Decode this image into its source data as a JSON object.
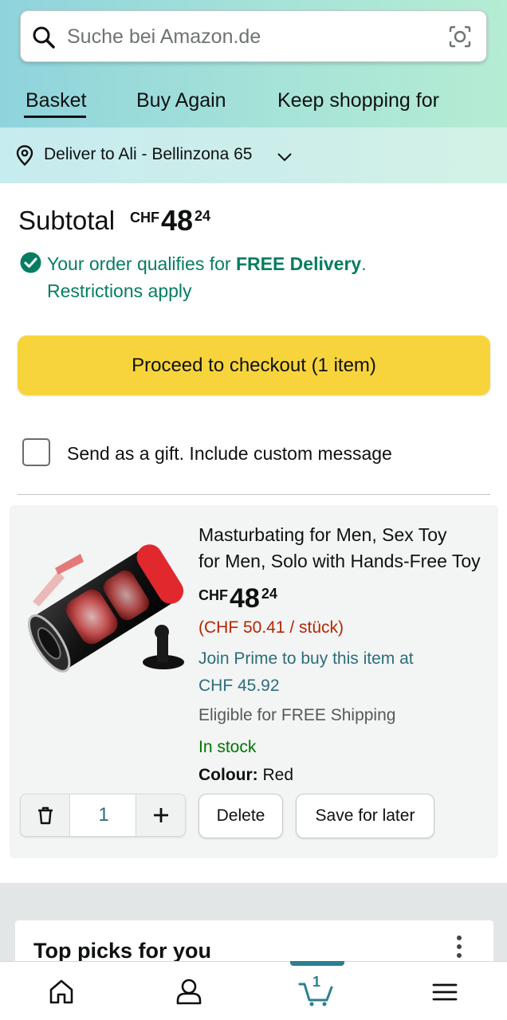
{
  "search": {
    "placeholder": "Suche bei Amazon.de"
  },
  "tabs": [
    {
      "label": "Basket",
      "active": true
    },
    {
      "label": "Buy Again",
      "active": false
    },
    {
      "label": "Keep shopping for",
      "active": false
    }
  ],
  "delivery": {
    "text": "Deliver to Ali - Bellinzona 65"
  },
  "subtotal": {
    "label": "Subtotal",
    "currency": "CHF",
    "whole": "48",
    "fraction": "24"
  },
  "free_delivery": {
    "prefix": "Your order qualifies for ",
    "bold": "FREE Delivery",
    "suffix": ".",
    "restrictions": "Restrictions apply"
  },
  "checkout": {
    "label": "Proceed to checkout (1 item)"
  },
  "gift": {
    "label": "Send as a gift. Include custom message",
    "checked": false
  },
  "item": {
    "title_line1": "Masturbating for Men, Sex Toy",
    "title_line2": "for Men, Solo with Hands-Free Toy",
    "currency": "CHF",
    "whole": "48",
    "fraction": "24",
    "unit_price": "(CHF 50.41 / stück)",
    "prime_line1": "Join Prime to buy this item at",
    "prime_line2": "CHF 45.92",
    "eligible": "Eligible for FREE Shipping",
    "stock": "In stock",
    "colour_label": "Colour:",
    "colour_value": "Red",
    "quantity": "1",
    "delete_label": "Delete",
    "save_label": "Save for later",
    "image_icon": "product-image"
  },
  "top_picks": {
    "title": "Top picks for you"
  },
  "bottom_nav": {
    "items": [
      "home-icon",
      "account-icon",
      "cart-icon",
      "menu-icon"
    ],
    "cart_count": "1",
    "active": "cart-icon"
  },
  "colors": {
    "accent_teal": "#067d62",
    "link_teal": "#2c6e7a",
    "checkout_yellow": "#f7d43c",
    "price_red": "#b12704",
    "stock_green": "#007600"
  }
}
